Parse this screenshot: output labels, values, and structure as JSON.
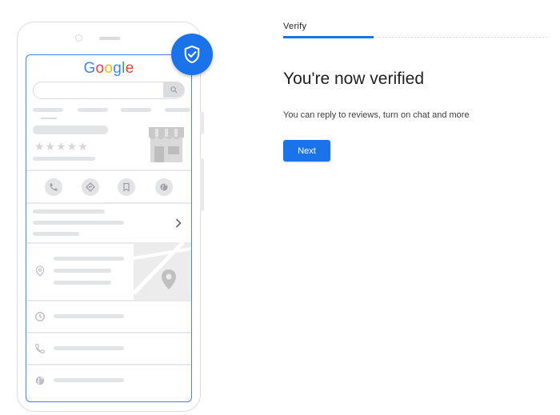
{
  "stepper": {
    "step_label": "Verify",
    "progress_fraction": 0.34
  },
  "main": {
    "title": "You're now verified",
    "subtitle": "You can reply to reviews, turn on chat and more",
    "next_label": "Next"
  },
  "illustration": {
    "logo_letters": [
      "G",
      "o",
      "o",
      "g",
      "l",
      "e"
    ],
    "logo_colors": [
      "#4285f4",
      "#ea4335",
      "#fbbc05",
      "#4285f4",
      "#34a853",
      "#ea4335"
    ],
    "rating_stars": "★★★★★",
    "badge_icon": "shield-check-icon",
    "action_icons": [
      "phone-icon",
      "directions-icon",
      "bookmark-icon",
      "globe-icon"
    ],
    "row_icons": [
      "location-pin-icon",
      "clock-icon",
      "phone-icon",
      "globe-icon"
    ]
  },
  "colors": {
    "accent": "#1a73e8",
    "placeholder": "#e3e4e6",
    "outline": "#dadce0"
  }
}
